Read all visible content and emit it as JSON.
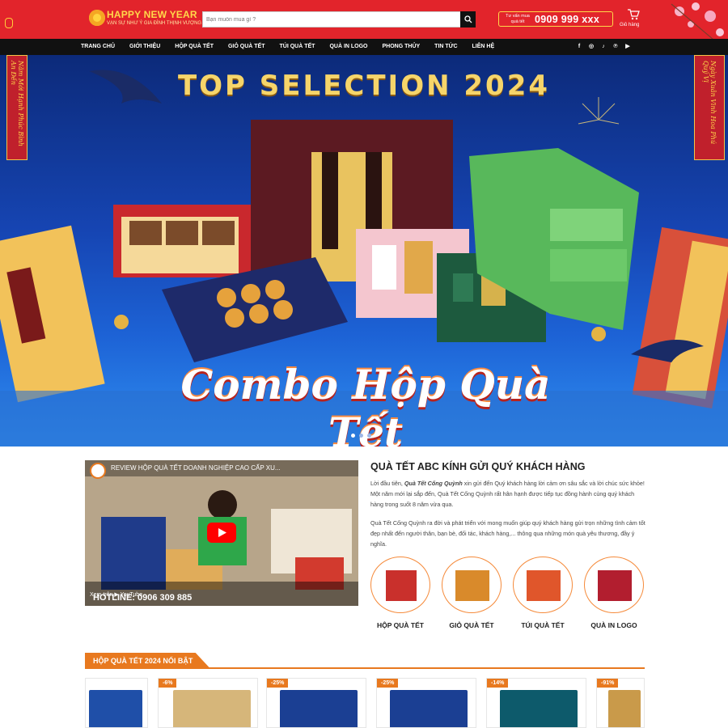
{
  "header": {
    "logo_title": "HAPPY NEW YEAR",
    "logo_subtitle": "VẠN SỰ NHƯ Ý GIA ĐÌNH THỊNH VƯỢNG",
    "search_placeholder": "Bạn muốn mua gì ?",
    "hotline_label": "Tư vấn mua quà tết",
    "hotline_phone": "0909 999 xxx",
    "cart_label": "Giỏ hàng",
    "colors": {
      "header_bg": "#e2242b",
      "nav_bg": "#111111",
      "accent": "#e8791f"
    }
  },
  "nav": {
    "items": [
      "TRANG CHỦ",
      "GIỚI THIỆU",
      "HỘP QUÀ TẾT",
      "GIỎ QUÀ TẾT",
      "TÚI QUÀ TẾT",
      "QUÀ IN LOGO",
      "PHONG THỦY",
      "TIN TỨC",
      "LIÊN HỆ"
    ],
    "socials": [
      "facebook-icon",
      "instagram-icon",
      "tiktok-icon",
      "pinterest-icon",
      "youtube-icon"
    ]
  },
  "hero": {
    "title": "TOP SELECTION 2024",
    "banner": "Combo Hộp Quà Tết",
    "left_scroll": "Năm Mới Hạnh Phúc Bình An Đến",
    "right_scroll": "Ngày Xuân Vinh Hoa Phú Quý Vị",
    "slides": 3,
    "active_slide": 1
  },
  "video": {
    "title": "REVIEW HỘP QUÀ TẾT DOANH NGHIỆP CAO CẤP XU...",
    "watch_label": "Xem trên",
    "youtube_label": "YouTube",
    "hotline": "HOTLINE: 0906 309 885"
  },
  "about": {
    "title": "QUÀ TẾT ABC KÍNH GỬI QUÝ KHÁCH HÀNG",
    "p1_prefix": "Lời đầu tiên, ",
    "p1_brand": "Quà Tết Cống Quỳnh",
    "p1_rest": " xin gửi đến Quý khách hàng lời cảm ơn sâu sắc và lời chúc sức khỏe! Một năm mới lại sắp đến, Quà Tết Cống Quỳnh rất hân hạnh được tiếp tục đồng hành cùng quý khách hàng trong suốt 8 năm vừa qua.",
    "p2": "Quà Tết Cống Quỳnh ra đời và phát triển với mong muốn giúp quý khách hàng gửi trọn những tình cảm tốt đẹp nhất đến người thân, bạn bè, đối tác, khách hàng,... thông qua những món quà yêu thương, đầy ý nghĩa."
  },
  "categories": [
    {
      "label": "HỘP QUÀ TẾT",
      "color": "#c9302c"
    },
    {
      "label": "GIỎ QUÀ TẾT",
      "color": "#d98a2b"
    },
    {
      "label": "TÚI QUÀ TẾT",
      "color": "#e0562b"
    },
    {
      "label": "QUÀ IN LOGO",
      "color": "#b21e2f"
    }
  ],
  "featured": {
    "title": "HỘP QUÀ TẾT 2024 NỔI BẬT",
    "products": [
      {
        "badge": "",
        "color": "#1f4fa8"
      },
      {
        "badge": "-6%",
        "color": "#d6b67a"
      },
      {
        "badge": "-25%",
        "color": "#1b3f93"
      },
      {
        "badge": "-25%",
        "color": "#1b3f93"
      },
      {
        "badge": "-14%",
        "color": "#0d5a6b"
      },
      {
        "badge": "-91%",
        "color": "#c99a4a"
      }
    ]
  }
}
